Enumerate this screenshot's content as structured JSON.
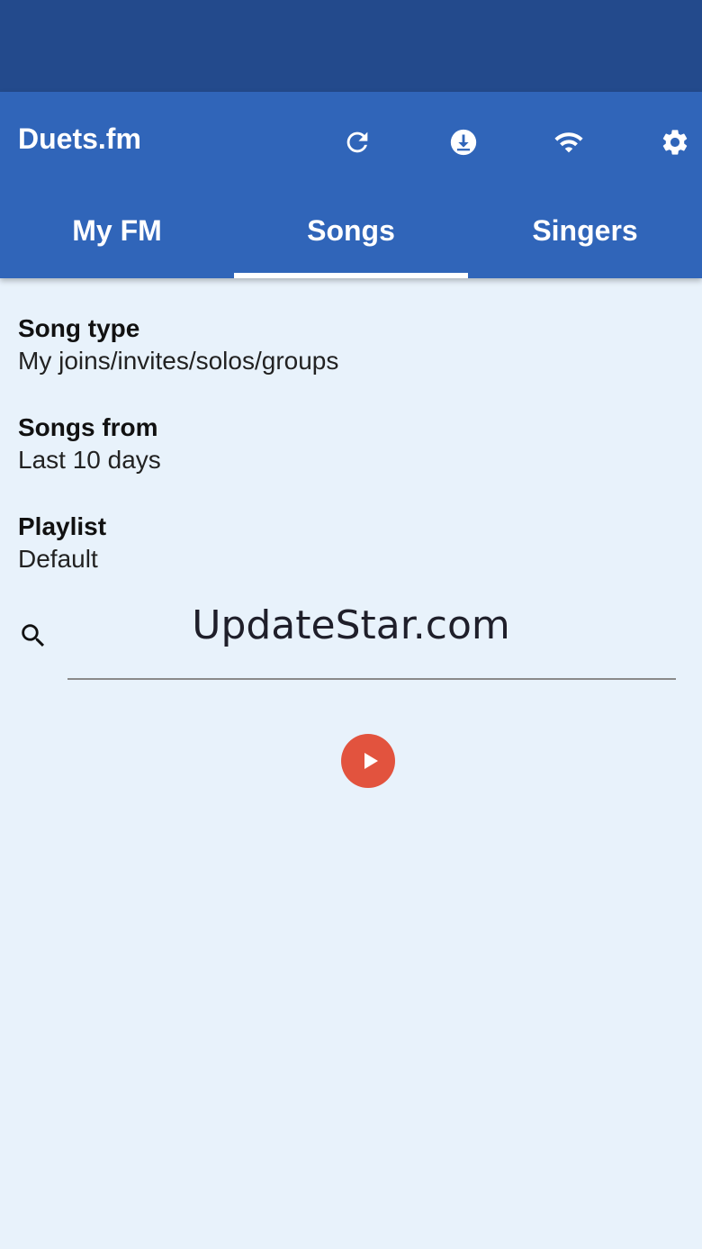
{
  "app": {
    "title": "Duets.fm"
  },
  "toolbar": {
    "icons": [
      "refresh-icon",
      "download-icon",
      "wifi-icon",
      "settings-icon"
    ]
  },
  "tabs": [
    {
      "label": "My FM",
      "active": false
    },
    {
      "label": "Songs",
      "active": true
    },
    {
      "label": "Singers",
      "active": false
    }
  ],
  "filters": {
    "song_type": {
      "label": "Song type",
      "value": "My joins/invites/solos/groups"
    },
    "songs_from": {
      "label": "Songs from",
      "value": "Last 10 days"
    },
    "playlist": {
      "label": "Playlist",
      "value": "Default"
    }
  },
  "search": {
    "value": "",
    "placeholder": ""
  },
  "watermark": "UpdateStar.com",
  "colors": {
    "status_bar": "#234a8c",
    "app_bar": "#3065b9",
    "background": "#e8f2fb",
    "play_button": "#e2533e"
  }
}
